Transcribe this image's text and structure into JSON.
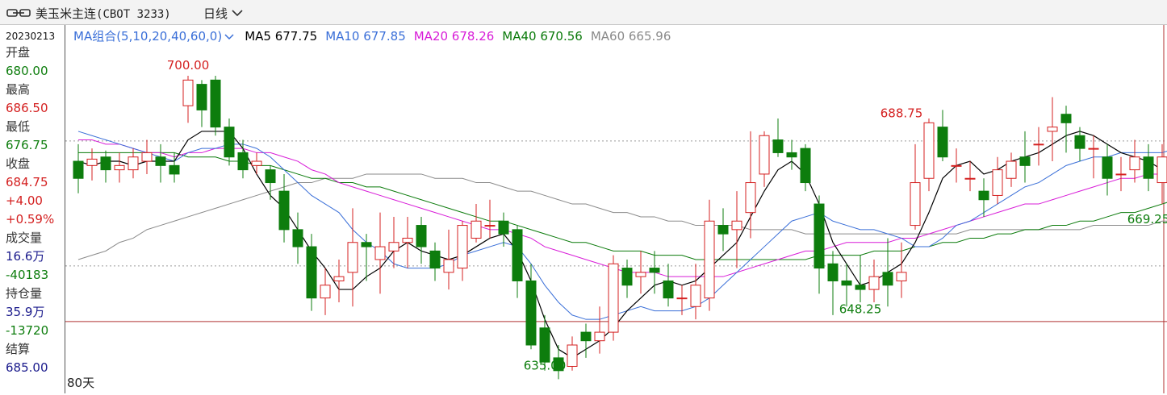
{
  "header": {
    "title": "美玉米主连",
    "contract": "(CBOT 3233)",
    "period": "日线"
  },
  "icons": {
    "link": "link-icon",
    "chevron": "chevron-down-icon"
  },
  "ma_bar": {
    "group_label": "MA组合(5,10,20,40,60,0)",
    "items": [
      {
        "key": "ma5",
        "label": "MA5 677.75",
        "color": "#000000"
      },
      {
        "key": "ma10",
        "label": "MA10 677.85",
        "color": "#3a6fd8"
      },
      {
        "key": "ma20",
        "label": "MA20 678.26",
        "color": "#d81cd8"
      },
      {
        "key": "ma40",
        "label": "MA40 670.56",
        "color": "#0a7a0a"
      },
      {
        "key": "ma60",
        "label": "MA60 665.96",
        "color": "#8a8a8a"
      }
    ]
  },
  "sidebar": {
    "date": "20230213",
    "open_label": "开盘",
    "open": "680.00",
    "high_label": "最高",
    "high": "686.50",
    "low_label": "最低",
    "low": "676.75",
    "close_label": "收盘",
    "close": "684.75",
    "change": "+4.00",
    "change_pct": "+0.59%",
    "volume_label": "成交量",
    "volume": "16.6万",
    "volume_change": "-40183",
    "oi_label": "持仓量",
    "oi": "35.9万",
    "oi_change": "-13720",
    "settle_label": "结算",
    "settle": "685.00"
  },
  "footer": {
    "days": "80天"
  },
  "colors": {
    "up": "#d42020",
    "down": "#0d7d0d",
    "red": "#d42020",
    "green": "#0d7d0d",
    "navy": "#1a1a8c"
  },
  "chart_data": {
    "type": "candlestick",
    "ylim": [
      627,
      710
    ],
    "annotations": [
      {
        "text": "700.00",
        "index": 8,
        "value": 700.0,
        "kind": "high"
      },
      {
        "text": "635.00",
        "index": 34,
        "value": 635.0,
        "kind": "low"
      },
      {
        "text": "648.25",
        "index": 57,
        "value": 648.25,
        "kind": "low"
      },
      {
        "text": "688.75",
        "index": 60,
        "value": 688.75,
        "kind": "high"
      },
      {
        "text": "669.25",
        "index": 78,
        "value": 669.25,
        "kind": "low"
      }
    ],
    "reference_lines": [
      {
        "value": 684.75,
        "style": "dotted"
      },
      {
        "value": 655.5,
        "style": "dotted"
      }
    ],
    "crosshair": {
      "index": 79,
      "value": 642.5
    },
    "candles": [
      [
        680,
        676,
        684,
        672.5
      ],
      [
        679,
        680.5,
        683,
        675.5
      ],
      [
        681,
        678,
        682.5,
        675
      ],
      [
        678,
        679,
        682,
        675
      ],
      [
        678,
        681,
        683,
        676
      ],
      [
        680,
        682,
        685,
        677
      ],
      [
        681,
        679,
        684,
        675
      ],
      [
        679,
        677,
        682,
        675
      ],
      [
        693,
        699,
        700,
        689
      ],
      [
        698,
        692,
        699,
        688
      ],
      [
        699,
        688,
        700,
        686
      ],
      [
        688,
        681,
        690,
        679
      ],
      [
        682,
        678,
        685,
        676
      ],
      [
        679,
        680,
        682,
        677
      ],
      [
        678,
        675,
        679,
        671
      ],
      [
        673,
        664,
        677,
        661
      ],
      [
        664,
        660,
        668,
        656
      ],
      [
        660,
        648,
        663,
        645
      ],
      [
        648,
        651,
        655,
        644
      ],
      [
        652,
        653,
        657,
        647
      ],
      [
        654,
        661,
        669,
        646
      ],
      [
        661,
        660,
        663,
        652
      ],
      [
        657,
        660,
        668,
        649
      ],
      [
        659,
        661,
        667,
        655
      ],
      [
        661,
        662,
        667,
        655
      ],
      [
        665,
        660,
        667,
        656
      ],
      [
        659,
        655,
        661,
        652
      ],
      [
        654,
        657,
        664,
        650
      ],
      [
        655,
        665,
        666,
        652
      ],
      [
        662,
        666,
        670,
        661
      ],
      [
        665,
        665,
        671,
        662
      ],
      [
        666,
        663,
        668,
        660
      ],
      [
        664,
        652,
        665,
        648
      ],
      [
        652,
        637,
        656,
        636
      ],
      [
        641,
        633,
        644,
        631
      ],
      [
        634,
        631,
        637,
        629
      ],
      [
        632,
        637,
        639,
        631
      ],
      [
        640,
        638,
        642,
        634
      ],
      [
        638,
        640,
        646,
        635
      ],
      [
        640,
        656,
        658,
        638
      ],
      [
        655,
        651,
        657,
        648
      ],
      [
        653,
        654,
        659,
        649
      ],
      [
        655,
        654,
        659,
        649
      ],
      [
        652,
        648,
        656,
        646
      ],
      [
        648,
        648,
        651,
        644
      ],
      [
        646,
        651,
        656,
        643
      ],
      [
        648,
        666,
        671,
        645
      ],
      [
        665,
        663,
        669,
        659
      ],
      [
        664,
        666,
        673,
        655
      ],
      [
        668,
        675,
        687,
        662
      ],
      [
        677,
        686,
        687,
        674
      ],
      [
        685,
        682,
        690,
        681
      ],
      [
        682,
        681,
        685,
        678
      ],
      [
        683,
        675,
        684,
        673
      ],
      [
        670,
        655,
        672,
        649
      ],
      [
        656,
        652,
        659,
        644
      ],
      [
        652,
        651,
        656,
        646
      ],
      [
        651,
        650,
        658,
        647
      ],
      [
        650,
        653,
        657,
        647
      ],
      [
        654,
        651,
        662,
        646
      ],
      [
        652,
        654,
        661,
        648
      ],
      [
        665,
        675,
        684,
        664
      ],
      [
        676,
        689,
        690,
        673
      ],
      [
        688,
        681,
        692,
        680
      ],
      [
        679,
        679,
        683,
        675
      ],
      [
        676,
        676,
        680,
        673
      ],
      [
        673,
        671,
        676,
        667
      ],
      [
        672,
        678,
        681,
        670
      ],
      [
        676,
        680,
        682,
        674
      ],
      [
        681,
        679,
        687,
        675
      ],
      [
        684,
        684,
        688,
        679
      ],
      [
        687,
        688,
        695,
        680
      ],
      [
        691,
        689,
        693,
        682
      ],
      [
        686,
        683,
        688,
        680
      ],
      [
        683,
        683,
        686,
        676
      ],
      [
        681,
        676,
        684,
        672
      ],
      [
        677,
        677,
        681,
        673
      ],
      [
        678,
        681,
        685,
        675
      ],
      [
        681,
        676,
        684,
        673
      ],
      [
        675,
        681,
        684,
        670
      ],
      [
        680,
        685,
        686.5,
        676.75
      ]
    ],
    "series": [
      {
        "name": "MA5",
        "color": "#000000",
        "values": [
          680,
          679,
          680,
          680,
          679,
          680,
          680,
          680,
          685,
          687,
          687,
          687,
          683,
          677,
          672,
          669,
          664,
          659,
          655,
          650,
          650,
          653,
          655,
          659,
          661,
          659,
          658,
          657,
          658,
          660,
          662,
          663,
          659,
          652,
          643,
          636,
          634,
          636,
          638,
          641,
          645,
          648,
          651,
          652,
          651,
          652,
          655,
          658,
          661,
          667,
          673,
          678,
          680,
          677,
          670,
          661,
          656,
          651,
          652,
          654,
          656,
          661,
          668,
          676,
          679,
          680,
          677,
          678,
          680,
          681,
          682,
          684,
          686,
          687,
          686,
          684,
          682,
          681,
          680,
          678,
          679
        ]
      },
      {
        "name": "MA10",
        "color": "#3a6fd8",
        "values": [
          687,
          686,
          685,
          684,
          683,
          682,
          681,
          680,
          682,
          683,
          683,
          684,
          684,
          683,
          681,
          678,
          675,
          672,
          670,
          668,
          664,
          661,
          659,
          656,
          655,
          655,
          655,
          656,
          658,
          659,
          660,
          661,
          660,
          656,
          651,
          647,
          644,
          643,
          643,
          644,
          645,
          646,
          645,
          645,
          645,
          646,
          648,
          651,
          654,
          657,
          660,
          663,
          666,
          667,
          668,
          666,
          665,
          664,
          664,
          663,
          662,
          660,
          660,
          662,
          665,
          666,
          668,
          670,
          672,
          674,
          675,
          677,
          679,
          680,
          681,
          681,
          682,
          682,
          682,
          682,
          683
        ]
      },
      {
        "name": "MA20",
        "color": "#d81cd8",
        "values": [
          685,
          685,
          684,
          684,
          683,
          682,
          682,
          681,
          682,
          682,
          683,
          683,
          683,
          682,
          682,
          681,
          680,
          678,
          677,
          675,
          674,
          673,
          672,
          671,
          670,
          669,
          668,
          667,
          666,
          665,
          664,
          664,
          663,
          662,
          660,
          659,
          658,
          657,
          656,
          655,
          654,
          654,
          654,
          653,
          653,
          653,
          653,
          653,
          654,
          655,
          656,
          657,
          658,
          659,
          659,
          660,
          661,
          661,
          661,
          661,
          662,
          662,
          663,
          664,
          665,
          666,
          667,
          668,
          669,
          670,
          670,
          671,
          672,
          673,
          674,
          675,
          676,
          676,
          677,
          677,
          678
        ]
      },
      {
        "name": "MA40",
        "color": "#0a7a0a",
        "values": [
          682,
          682,
          682,
          682,
          682,
          682,
          682,
          682,
          681,
          681,
          681,
          680,
          680,
          679,
          679,
          678,
          677,
          676,
          676,
          675,
          675,
          674,
          674,
          673,
          672,
          671,
          670,
          669,
          668,
          667,
          666,
          666,
          665,
          664,
          663,
          662,
          661,
          661,
          660,
          659,
          659,
          659,
          658,
          658,
          658,
          657,
          657,
          657,
          657,
          657,
          657,
          657,
          657,
          657,
          658,
          658,
          658,
          658,
          659,
          659,
          659,
          660,
          660,
          661,
          661,
          662,
          662,
          663,
          663,
          664,
          664,
          665,
          665,
          666,
          666,
          667,
          668,
          668,
          669,
          670,
          671
        ]
      },
      {
        "name": "MA60",
        "color": "#8a8a8a",
        "values": [
          657,
          658,
          659,
          661,
          662,
          664,
          665,
          666,
          667,
          668,
          669,
          670,
          671,
          672,
          673,
          674,
          675,
          675,
          676,
          676,
          676,
          677,
          677,
          677,
          677,
          677,
          676,
          676,
          676,
          675,
          675,
          674,
          673,
          673,
          672,
          671,
          670,
          670,
          669,
          668,
          668,
          667,
          667,
          666,
          666,
          665,
          665,
          665,
          665,
          664,
          664,
          664,
          664,
          663,
          663,
          663,
          663,
          663,
          663,
          663,
          663,
          663,
          663,
          663,
          663,
          664,
          664,
          664,
          664,
          664,
          664,
          664,
          664,
          664,
          665,
          665,
          665,
          665,
          665,
          666,
          666
        ]
      }
    ]
  }
}
